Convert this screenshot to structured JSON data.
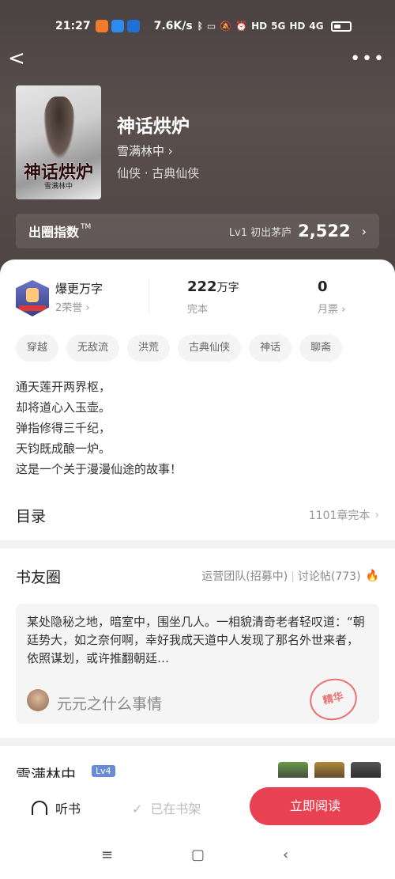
{
  "status": {
    "time": "21:27",
    "speed": "7.6K/s",
    "hd1": "HD",
    "net1": "5G",
    "hd2": "HD",
    "net2": "4G"
  },
  "nav": {
    "back_label": "<",
    "more_label": "•••"
  },
  "book": {
    "title": "神话烘炉",
    "author": "雪满林中",
    "genre": "仙侠 · 古典仙侠",
    "cover_title": "神话烘炉",
    "cover_author": "雪满林中"
  },
  "index": {
    "label": "出圈指数",
    "tm": "TM",
    "level": "Lv1 初出茅庐",
    "value": "2,522"
  },
  "stats": {
    "badge_title": "爆更万字",
    "badge_sub": "2荣誉",
    "words_num": "222",
    "words_unit": "万字",
    "words_sub": "完本",
    "tickets_num": "0",
    "tickets_sub": "月票"
  },
  "tags": [
    "穿越",
    "无敌流",
    "洪荒",
    "古典仙侠",
    "神话",
    "聊斋"
  ],
  "intro": [
    "通天莲开两界枢，",
    "却将道心入玉壶。",
    "弹指修得三千纪，",
    "天钧既成酿一炉。",
    "这是一个关于漫漫仙途的故事！"
  ],
  "toc": {
    "label": "目录",
    "value": "1101章完本"
  },
  "circle": {
    "label": "书友圈",
    "ops_team": "运营团队(招募中)",
    "ops_posts": "讨论帖(773)",
    "post_text": "某处隐秘之地，暗室中，围坐几人。一相貌清奇老者轻叹道：“朝廷势大，如之奈何啊，幸好我成天道中人发现了那名外世来者，依照谋划，或许推翻朝廷…",
    "poster": "元元之什么事情",
    "stamp": "精华"
  },
  "peek": {
    "name": "雪满林中",
    "lv": "Lv4"
  },
  "bottom": {
    "listen": "听书",
    "onshelf": "已在书架",
    "read": "立即阅读"
  },
  "colors": {
    "accent": "#e94154",
    "hero": "#4e4443"
  }
}
